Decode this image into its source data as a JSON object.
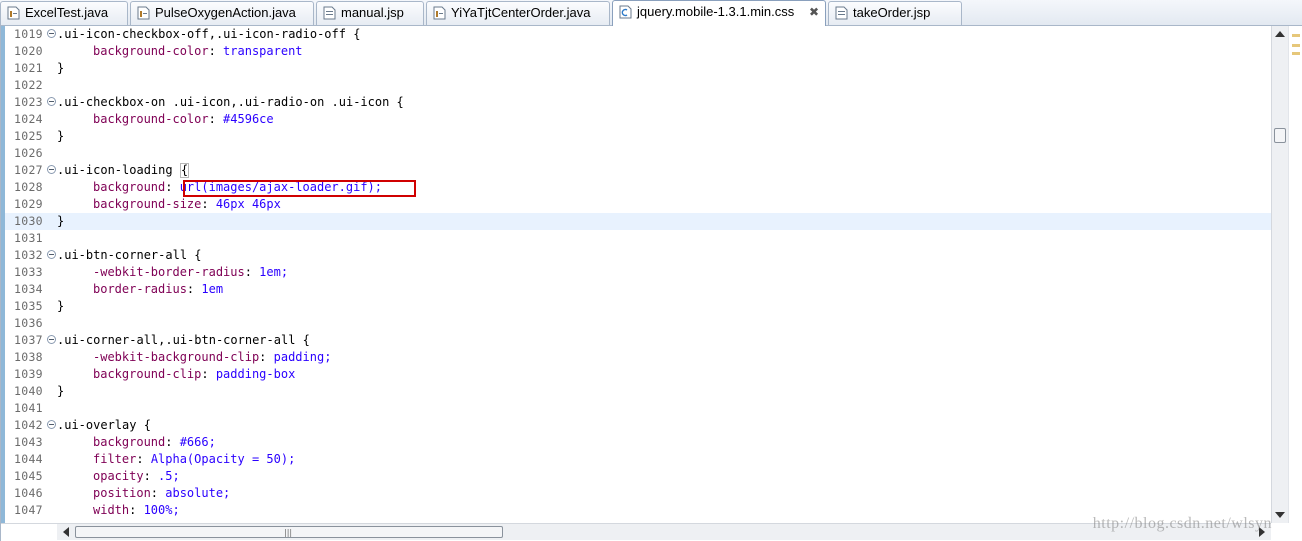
{
  "tabs": [
    {
      "label": "ExcelTest.java",
      "icon": "java-file-icon",
      "active": false
    },
    {
      "label": "PulseOxygenAction.java",
      "icon": "java-file-icon",
      "active": false
    },
    {
      "label": "manual.jsp",
      "icon": "jsp-file-icon",
      "active": false
    },
    {
      "label": "YiYaTjtCenterOrder.java",
      "icon": "java-file-icon",
      "active": false
    },
    {
      "label": "jquery.mobile-1.3.1.min.css",
      "icon": "css-file-icon",
      "active": true,
      "close": "✖"
    },
    {
      "label": "takeOrder.jsp",
      "icon": "jsp-file-icon",
      "active": false
    }
  ],
  "editor": {
    "lines": [
      {
        "n": "1019",
        "fold": true,
        "sel": ".ui-icon-checkbox-off,.ui-icon-radio-off {"
      },
      {
        "n": "1020",
        "prop": "background-color",
        "val": "transparent"
      },
      {
        "n": "1021",
        "sel": "}"
      },
      {
        "n": "1022",
        "sel": ""
      },
      {
        "n": "1023",
        "fold": true,
        "sel": ".ui-checkbox-on .ui-icon,.ui-radio-on .ui-icon {"
      },
      {
        "n": "1024",
        "prop": "background-color",
        "val": "#4596ce"
      },
      {
        "n": "1025",
        "sel": "}"
      },
      {
        "n": "1026",
        "sel": ""
      },
      {
        "n": "1027",
        "fold": true,
        "sel": ".ui-icon-loading ",
        "brace": "{"
      },
      {
        "n": "1028",
        "prop": "background",
        "val": "url(images/ajax-loader.gif);"
      },
      {
        "n": "1029",
        "prop": "background-size",
        "val": "46px 46px"
      },
      {
        "n": "1030",
        "sel": "}",
        "current": true
      },
      {
        "n": "1031",
        "sel": ""
      },
      {
        "n": "1032",
        "fold": true,
        "sel": ".ui-btn-corner-all {"
      },
      {
        "n": "1033",
        "prop": "-webkit-border-radius",
        "val": "1em;"
      },
      {
        "n": "1034",
        "prop": "border-radius",
        "val": "1em"
      },
      {
        "n": "1035",
        "sel": "}"
      },
      {
        "n": "1036",
        "sel": ""
      },
      {
        "n": "1037",
        "fold": true,
        "sel": ".ui-corner-all,.ui-btn-corner-all {"
      },
      {
        "n": "1038",
        "prop": "-webkit-background-clip",
        "val": "padding;"
      },
      {
        "n": "1039",
        "prop": "background-clip",
        "val": "padding-box"
      },
      {
        "n": "1040",
        "sel": "}"
      },
      {
        "n": "1041",
        "sel": ""
      },
      {
        "n": "1042",
        "fold": true,
        "sel": ".ui-overlay {"
      },
      {
        "n": "1043",
        "prop": "background",
        "val": "#666;"
      },
      {
        "n": "1044",
        "prop": "filter",
        "val": "Alpha(Opacity = 50);"
      },
      {
        "n": "1045",
        "prop": "opacity",
        "val": ".5;"
      },
      {
        "n": "1046",
        "prop": "position",
        "val": "absolute;"
      },
      {
        "n": "1047",
        "prop": "width",
        "val": "100%;"
      }
    ],
    "highlight_color": "#d00000",
    "current_line_color": "#e8f2fe"
  },
  "scrollbars": {
    "grip": "|||"
  },
  "watermark": "http://blog.csdn.net/wlsyn",
  "colors": {
    "property": "#7f0055",
    "value": "#2a00ff",
    "line_number": "#6b6b6b"
  }
}
